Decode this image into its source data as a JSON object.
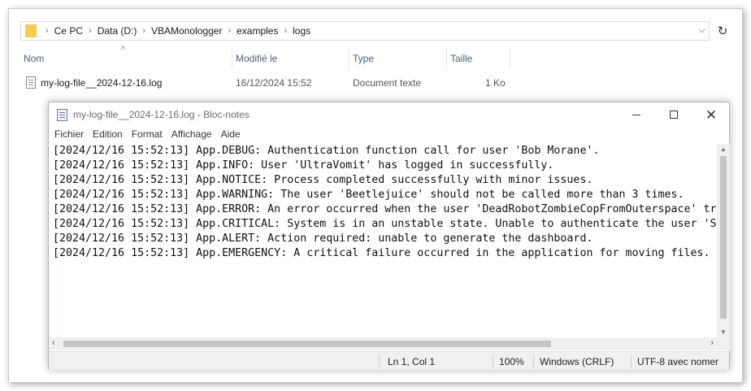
{
  "explorer": {
    "breadcrumb": [
      "Ce PC",
      "Data (D:)",
      "VBAMonologger",
      "examples",
      "logs"
    ],
    "columns": {
      "name": "Nom",
      "modified": "Modifié le",
      "type": "Type",
      "size": "Taille"
    },
    "files": [
      {
        "name": "my-log-file__2024-12-16.log",
        "modified": "16/12/2024 15:52",
        "type": "Document texte",
        "size": "1 Ko"
      }
    ]
  },
  "notepad": {
    "title": "my-log-file__2024-12-16.log - Bloc-notes",
    "menu": [
      "Fichier",
      "Edition",
      "Format",
      "Affichage",
      "Aide"
    ],
    "lines": [
      "[2024/12/16 15:52:13] App.DEBUG: Authentication function call for user 'Bob Morane'.",
      "[2024/12/16 15:52:13] App.INFO: User 'UltraVomit' has logged in successfully.",
      "[2024/12/16 15:52:13] App.NOTICE: Process completed successfully with minor issues.",
      "[2024/12/16 15:52:13] App.WARNING: The user 'Beetlejuice' should not be called more than 3 times.",
      "[2024/12/16 15:52:13] App.ERROR: An error occurred when the user 'DeadRobotZombieCopFromOuterspace' tr",
      "[2024/12/16 15:52:13] App.CRITICAL: System is in an unstable state. Unable to authenticate the user 'S",
      "[2024/12/16 15:52:13] App.ALERT: Action required: unable to generate the dashboard.",
      "[2024/12/16 15:52:13] App.EMERGENCY: A critical failure occurred in the application for moving files."
    ],
    "status": {
      "position": "Ln 1, Col 1",
      "zoom": "100%",
      "line_ending": "Windows (CRLF)",
      "encoding": "UTF-8 avec nomer"
    }
  }
}
